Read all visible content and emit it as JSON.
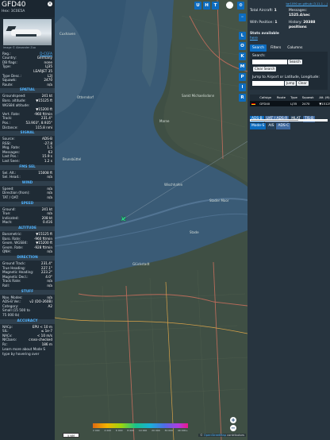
{
  "aircraft": {
    "callsign": "GFD40",
    "hex_label": "Hex:",
    "hex": "3C0E5A",
    "photo_credit": "Image © Alexander Zuo",
    "rows_top": [
      {
        "k": "Reg.:",
        "v": "D-CGFA",
        "link": true
      },
      {
        "k": "Country:",
        "v": "Germany"
      },
      {
        "k": "DB flags:",
        "v": "none"
      },
      {
        "k": "Type:",
        "v": "LJ35"
      },
      {
        "k": "",
        "v": "LEARJET 35"
      },
      {
        "k": "Type Desc.:",
        "v": "L2J"
      },
      {
        "k": "Squawk:",
        "v": "2470"
      },
      {
        "k": "Route:",
        "v": "n/a"
      }
    ]
  },
  "sections": [
    {
      "title": "SPATIAL",
      "rows": [
        {
          "k": "Groundspeed:",
          "v": "241 kt"
        },
        {
          "k": "Baro. altitude:",
          "v": "▼15125 ft"
        },
        {
          "k": "WGS84 altitude:",
          "v": ""
        },
        {
          "k": "",
          "v": "▼15200 ft"
        },
        {
          "k": "Vert. Rate:",
          "v": "-960 ft/min"
        },
        {
          "k": "Track:",
          "v": "231.4°"
        },
        {
          "k": "Pos.:",
          "v": "53.903°, 8.935°"
        },
        {
          "k": "Distance:",
          "v": "115.8 nmi"
        }
      ]
    },
    {
      "title": "SIGNAL",
      "rows": [
        {
          "k": "Source:",
          "v": "ADS-B"
        },
        {
          "k": "RSSI:",
          "v": "-27.8"
        },
        {
          "k": "Msg. Rate:",
          "v": "1.5"
        },
        {
          "k": "Messages:",
          "v": "63"
        },
        {
          "k": "Last Pos.:",
          "v": "15.9 s"
        },
        {
          "k": "Last Seen:",
          "v": "1.2 s"
        }
      ]
    },
    {
      "title": "FMS SEL",
      "rows": [
        {
          "k": "Sel. Alt.:",
          "v": "15008 ft"
        },
        {
          "k": "Sel. Head.:",
          "v": "n/a"
        }
      ]
    },
    {
      "title": "WIND",
      "rows": [
        {
          "k": "Speed:",
          "v": "n/a"
        },
        {
          "k": "Direction (from):",
          "v": "n/a"
        },
        {
          "k": "TAT / OAT:",
          "v": "n/a"
        }
      ]
    },
    {
      "title": "SPEED",
      "rows": [
        {
          "k": "Ground:",
          "v": "241 kt"
        },
        {
          "k": "True:",
          "v": "n/a"
        },
        {
          "k": "Indicated:",
          "v": "208 kt"
        },
        {
          "k": "Mach:",
          "v": "0.416"
        }
      ]
    },
    {
      "title": "ALTITUDE",
      "rows": [
        {
          "k": "Barometric:",
          "v": "▼15125 ft"
        },
        {
          "k": "Baro. Rate:",
          "v": "-960 ft/min"
        },
        {
          "k": "Geom. WGS84:",
          "v": "▼15200 ft"
        },
        {
          "k": "Geom. Rate:",
          "v": "-928 ft/min"
        },
        {
          "k": "QNH:",
          "v": "n/a"
        }
      ]
    },
    {
      "title": "DIRECTION",
      "rows": [
        {
          "k": "Ground Track:",
          "v": "231.4°"
        },
        {
          "k": "True Heading:",
          "v": "227.1°"
        },
        {
          "k": "Magnetic Heading:",
          "v": "223.2°"
        },
        {
          "k": "Magnetic Decl.:",
          "v": "4.0°"
        },
        {
          "k": "Track Rate:",
          "v": "n/a"
        },
        {
          "k": "Roll:",
          "v": "n/a"
        }
      ]
    },
    {
      "title": "STUFF",
      "rows": [
        {
          "k": "Nav. Modes:",
          "v": "n/a"
        },
        {
          "k": "ADS-B Ver.:",
          "v": "v2 (DO-260B)"
        },
        {
          "k": "Category:",
          "v": "A2"
        },
        {
          "k": "Small (15 500 to",
          "v": ""
        },
        {
          "k": "75 000 lb)",
          "v": ""
        }
      ]
    },
    {
      "title": "ACCURACY",
      "rows": [
        {
          "k": "NACp:",
          "v": "EPU < 10 m"
        },
        {
          "k": "SIL:",
          "v": "≤ 1e-7"
        },
        {
          "k": "NACv:",
          "v": "< 10 m/s"
        },
        {
          "k": "NICbaro:",
          "v": "cross-checked"
        },
        {
          "k": "Rc:",
          "v": "186 m"
        }
      ]
    }
  ],
  "footer_note": "Learn more about Mode S type by hovering over",
  "map": {
    "top_buttons": [
      "U",
      "H",
      "T"
    ],
    "side_buttons": [
      "L",
      "O",
      "K",
      "M",
      "P",
      "I",
      "R"
    ],
    "labels": [
      "Cuxhaven",
      "Otterndorf",
      "Brunsbüttel",
      "Wischhafen",
      "Stade",
      "Glückstadt",
      "Sankt Michaelisdonn",
      "Marne",
      "Stader Moor"
    ],
    "scale": "5 NM",
    "alt_ticks": [
      "2 000",
      "4 000",
      "6 000",
      "8 000",
      "10 000",
      "20 000",
      "30 000",
      "40 000+"
    ],
    "attribution_prefix": "© ",
    "attribution_link": "OpenStreetMap",
    "attribution_suffix": " contributors"
  },
  "right": {
    "github": "tar1090 on github (3.11.1 ...)",
    "total_label": "Total Aircraft:",
    "total": "1",
    "msgs_label": "Messages:",
    "msgs": "1525.4/sec",
    "withpos_label": "With Position:",
    "withpos": "1",
    "history_label": "History:",
    "history": "20388 positions",
    "stats_label": "Stats available",
    "stats_link": "here",
    "tabs": [
      "Search",
      "Filters",
      "Columns"
    ],
    "search_label": "Search:",
    "search_btn": "Search",
    "clear_btn": "Clear Search",
    "jump_label": "Jump to Airport or Latitude, Longitude:",
    "jump_btn": "Jump",
    "clear2_btn": "Clear",
    "columns": [
      "",
      "Callsign",
      "Route",
      "Type",
      "Squawk",
      "Alt. (ft)",
      "Spd"
    ],
    "rows": [
      [
        "",
        "GFD40",
        "",
        "LJ35",
        "2470",
        "▼15125",
        ""
      ]
    ],
    "filters": [
      "ADS-B",
      "UAT / ADS-R",
      "MLAT",
      "TIS-B",
      "Mode-S",
      "AIS",
      "ADS-C"
    ]
  }
}
